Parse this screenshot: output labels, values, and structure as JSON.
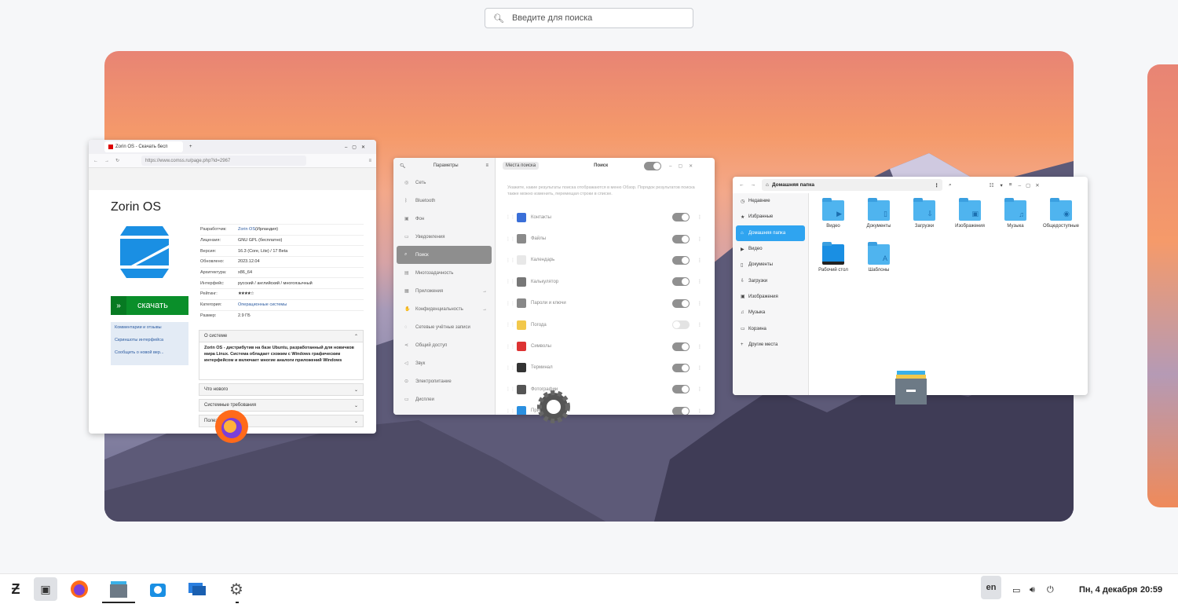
{
  "search": {
    "placeholder": "Введите для поиска"
  },
  "firefox": {
    "tab_title": "Zorin OS - Скачать бесп",
    "url": "https://www.comss.ru/page.php?id=2967",
    "page_title": "Zorin OS",
    "download_label": "скачать",
    "links": [
      "Комментарии и отзывы",
      "Скриншоты интерфейса",
      "Сообщить о новой вер..."
    ],
    "info": [
      {
        "k": "Разработчик:",
        "v": "Zorin OS",
        "v2": " (Ирландия)"
      },
      {
        "k": "Лицензия:",
        "v": "GNU GPL (бесплатно)"
      },
      {
        "k": "Версия:",
        "v": "16.3 (Core, Lite) / 17 Beta"
      },
      {
        "k": "Обновлено:",
        "v": "2023.12.04"
      },
      {
        "k": "Архитектура:",
        "v": "x86_64"
      },
      {
        "k": "Интерфейс:",
        "v": "русский / английский / многоязычный"
      },
      {
        "k": "Рейтинг:",
        "v": "★★★★☆"
      },
      {
        "k": "Категория:",
        "v": "Операционные системы"
      },
      {
        "k": "Размер:",
        "v": "2.9 ГБ"
      }
    ],
    "sections": {
      "about": "О системе",
      "news": "Что нового",
      "req": "Системные требования",
      "more": "Полезные ссылки"
    },
    "about_text": "Zorin OS - дистрибутив на базе Ubuntu, разработанный для новичков мира Linux. Система обладает схожим с Windows графическим интерфейсом и включает многие аналоги приложений Windows"
  },
  "settings": {
    "title": "Параметры",
    "tab": "Места поиска",
    "heading": "Поиск",
    "sidebar": [
      "Сеть",
      "Bluetooth",
      "Фон",
      "Уведомления",
      "Поиск",
      "Многозадачность",
      "Приложения",
      "Конфиденциальность",
      "Сетевые учётные записи",
      "Общий доступ",
      "Звук",
      "Электропитание",
      "Дисплеи"
    ],
    "description": "Укажите, какие результаты поиска отображаются в меню Обзор. Порядок результатов поиска также можно изменить, перемещая строки в списке.",
    "rows": [
      {
        "label": "Контакты",
        "color": "#3a6fd8",
        "on": true
      },
      {
        "label": "Файлы",
        "color": "#8a8a8a",
        "on": true
      },
      {
        "label": "Календарь",
        "color": "#e8e8e8",
        "on": true
      },
      {
        "label": "Калькулятор",
        "color": "#777",
        "on": true
      },
      {
        "label": "Пароли и ключи",
        "color": "#888",
        "on": true
      },
      {
        "label": "Погода",
        "color": "#f2c84b",
        "on": false
      },
      {
        "label": "Символы",
        "color": "#d33",
        "on": true
      },
      {
        "label": "Терминал",
        "color": "#333",
        "on": true
      },
      {
        "label": "Фотографии",
        "color": "#555",
        "on": true
      },
      {
        "label": "Приложений",
        "color": "#2a8fe0",
        "on": true
      }
    ]
  },
  "files": {
    "path": "Домашняя папка",
    "sidebar": [
      "Недавние",
      "Избранные",
      "Домашняя папка",
      "Видео",
      "Документы",
      "Загрузки",
      "Изображения",
      "Музыка",
      "Корзина",
      "Другие места"
    ],
    "items": [
      "Видео",
      "Документы",
      "Загрузки",
      "Изображения",
      "Музыка",
      "Общедоступные",
      "Рабочий стол",
      "Шаблоны"
    ]
  },
  "tray": {
    "lang": "en",
    "date": "Пн, 4 декабря",
    "time": "20:59"
  }
}
